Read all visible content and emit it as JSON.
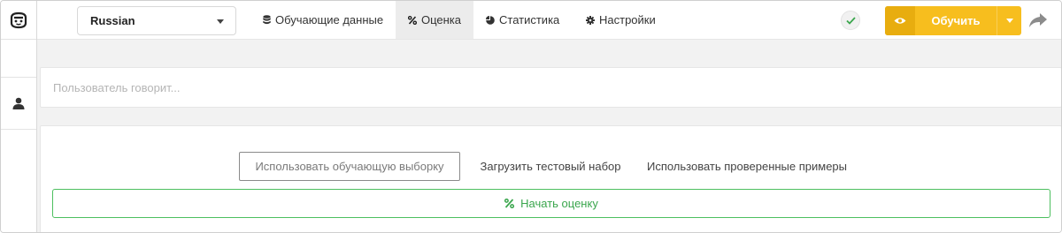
{
  "topbar": {
    "language": "Russian",
    "nav": [
      {
        "label": "Обучающие данные",
        "icon": "database-icon"
      },
      {
        "label": "Оценка",
        "icon": "percent-icon",
        "active": true
      },
      {
        "label": "Статистика",
        "icon": "pie-chart-icon"
      },
      {
        "label": "Настройки",
        "icon": "gear-icon"
      }
    ],
    "status_icon": "check-icon",
    "train_label": "Обучить",
    "colors": {
      "train": "#f7be1e",
      "train_dark": "#e8ad0f",
      "active_tab": "#ececec"
    }
  },
  "sidebar": {
    "logo_icon": "bot-face-icon",
    "user_icon": "user-icon"
  },
  "chat": {
    "placeholder": "Пользователь говорит..."
  },
  "evaluation": {
    "tabs": [
      {
        "label": "Использовать обучающую выборку",
        "selected": true
      },
      {
        "label": "Загрузить тестовый набор"
      },
      {
        "label": "Использовать проверенные примеры"
      }
    ],
    "start_label": "Начать оценку",
    "start_color": "#3aa64d"
  }
}
